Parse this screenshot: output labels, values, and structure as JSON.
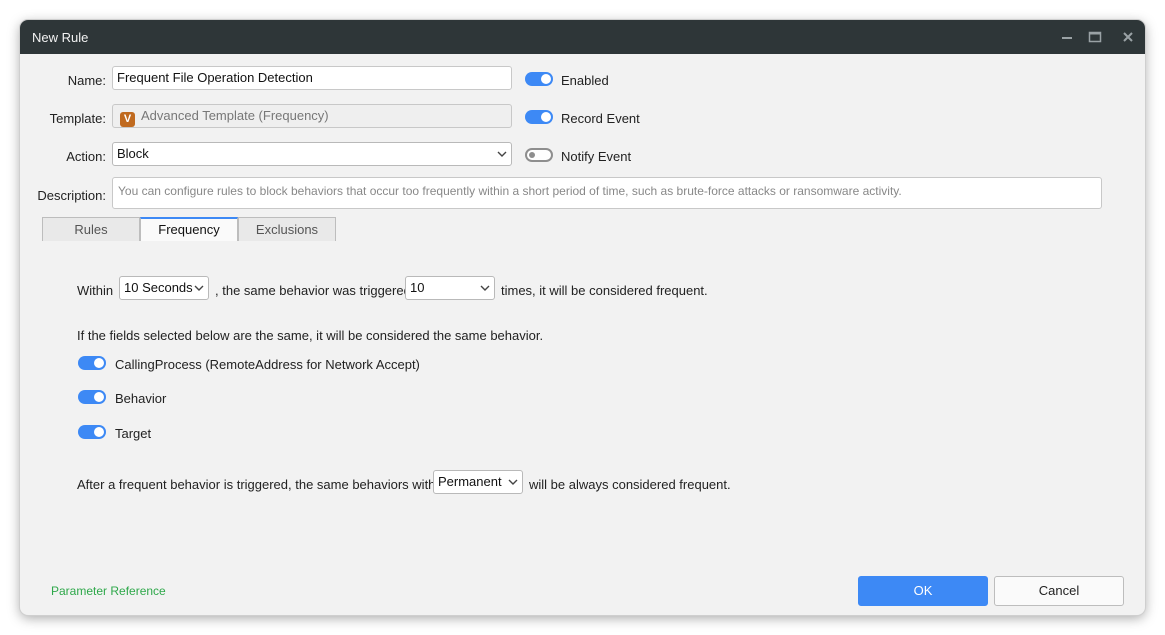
{
  "window": {
    "title": "New Rule",
    "controls": {
      "minimize": "minimize-icon",
      "maximize": "maximize-icon",
      "close": "close-icon"
    }
  },
  "form": {
    "name_label": "Name:",
    "name_value": "Frequent File Operation Detection",
    "template_label": "Template:",
    "template_icon_letter": "V",
    "template_value": "Advanced Template (Frequency)",
    "action_label": "Action:",
    "action_value": "Block",
    "description_label": "Description:",
    "description_placeholder": "You can configure rules to block behaviors that occur too frequently within a short period of time, such as brute-force attacks or ransomware activity."
  },
  "toggles": {
    "enabled": {
      "label": "Enabled",
      "on": true
    },
    "record_event": {
      "label": "Record Event",
      "on": true
    },
    "notify_event": {
      "label": "Notify Event",
      "on": false
    }
  },
  "tabs": [
    {
      "label": "Rules",
      "active": false
    },
    {
      "label": "Frequency",
      "active": true
    },
    {
      "label": "Exclusions",
      "active": false
    }
  ],
  "frequency": {
    "within_label": "Within",
    "within_value": "10 Seconds",
    "triggered_label": ", the same behavior was triggered",
    "times_value": "10",
    "times_label": "times, it will be considered frequent.",
    "fields_intro": "If the fields selected below are the same, it will be considered the same behavior.",
    "fields": [
      {
        "label": "CallingProcess  (RemoteAddress for Network Accept)",
        "on": true
      },
      {
        "label": "Behavior",
        "on": true
      },
      {
        "label": "Target",
        "on": true
      }
    ],
    "after_label": "After a frequent behavior is triggered, the same behaviors within",
    "after_value": "Permanent",
    "after_suffix": "will be always considered frequent."
  },
  "footer": {
    "parameter_reference": "Parameter Reference",
    "ok_label": "OK",
    "cancel_label": "Cancel"
  },
  "colors": {
    "accent": "#3d89f5",
    "titlebar": "#2e3638",
    "link": "#2ea84a",
    "template_icon": "#c06a1f"
  }
}
